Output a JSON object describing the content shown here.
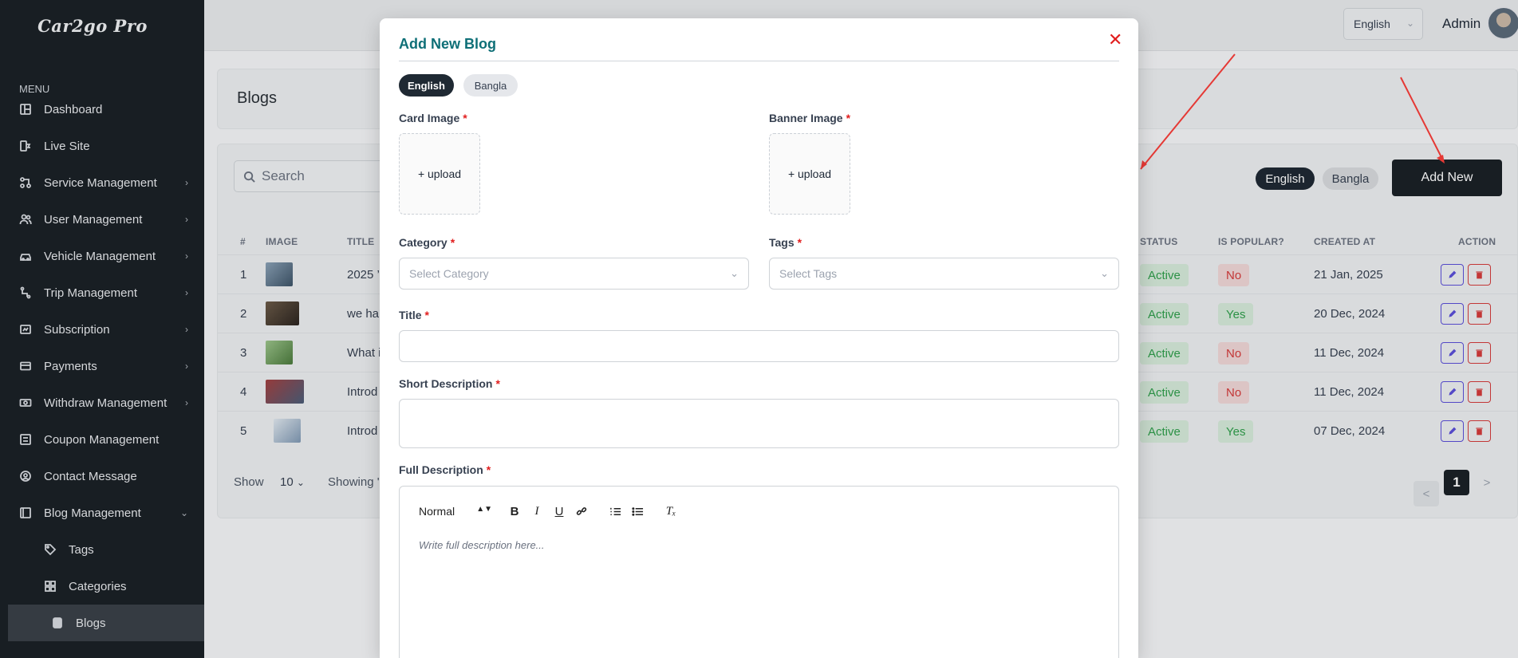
{
  "brand": {
    "logo_text": "Car2go Pro"
  },
  "sidebar": {
    "menu_title": "MENU",
    "items": [
      {
        "label": "Dashboard",
        "icon": "dashboard-icon",
        "has_children": false
      },
      {
        "label": "Live Site",
        "icon": "live-site-icon",
        "has_children": false
      },
      {
        "label": "Service Management",
        "icon": "service-icon",
        "has_children": true
      },
      {
        "label": "User Management",
        "icon": "users-icon",
        "has_children": true
      },
      {
        "label": "Vehicle Management",
        "icon": "car-icon",
        "has_children": true
      },
      {
        "label": "Trip Management",
        "icon": "trip-icon",
        "has_children": true
      },
      {
        "label": "Subscription",
        "icon": "subscription-icon",
        "has_children": true
      },
      {
        "label": "Payments",
        "icon": "payments-icon",
        "has_children": true
      },
      {
        "label": "Withdraw Management",
        "icon": "withdraw-icon",
        "has_children": true
      },
      {
        "label": "Coupon Management",
        "icon": "coupon-icon",
        "has_children": false
      },
      {
        "label": "Contact Message",
        "icon": "contact-icon",
        "has_children": false
      },
      {
        "label": "Blog Management",
        "icon": "blog-icon",
        "has_children": true,
        "expanded": true
      }
    ],
    "sub_items": [
      {
        "label": "Tags",
        "icon": "tags-icon"
      },
      {
        "label": "Categories",
        "icon": "categories-icon"
      },
      {
        "label": "Blogs",
        "icon": "blogs-icon",
        "active": true
      }
    ]
  },
  "header": {
    "language": "English",
    "admin_label": "Admin"
  },
  "page": {
    "title": "Blogs",
    "search_placeholder": "Search",
    "lang_tabs": [
      "English",
      "Bangla"
    ],
    "add_new_label": "Add New",
    "columns": {
      "num": "#",
      "image": "IMAGE",
      "title": "TITLE",
      "status": "STATUS",
      "popular": "IS POPULAR?",
      "created": "CREATED AT",
      "action": "ACTION"
    },
    "rows": [
      {
        "num": "1",
        "title": "2025 ’",
        "status": "Active",
        "popular": "No",
        "created": "21 Jan, 2025"
      },
      {
        "num": "2",
        "title": "we ha’",
        "status": "Active",
        "popular": "Yes",
        "created": "20 Dec, 2024"
      },
      {
        "num": "3",
        "title": "What i",
        "status": "Active",
        "popular": "No",
        "created": "11 Dec, 2024"
      },
      {
        "num": "4",
        "title": "Introd",
        "status": "Active",
        "popular": "No",
        "created": "11 Dec, 2024"
      },
      {
        "num": "5",
        "title": "Introd",
        "status": "Active",
        "popular": "Yes",
        "created": "07 Dec, 2024"
      }
    ],
    "show_label": "Show",
    "page_size": "10",
    "showing_text": "Showing '",
    "pagination": {
      "prev": "<",
      "current": "1",
      "next": ">"
    }
  },
  "modal": {
    "title": "Add New Blog",
    "close_glyph": "✕",
    "lang_tabs": [
      "English",
      "Bangla"
    ],
    "card_image_label": "Card Image",
    "banner_image_label": "Banner Image",
    "upload_text": "+ upload",
    "required_mark": "*",
    "category_label": "Category",
    "category_placeholder": "Select Category",
    "tags_label": "Tags",
    "tags_placeholder": "Select Tags",
    "title_label": "Title",
    "short_desc_label": "Short Description",
    "full_desc_label": "Full Description",
    "editor": {
      "format_value": "Normal",
      "placeholder": "Write full description here..."
    }
  },
  "colors": {
    "sidebar_bg": "#1b2127",
    "accent_teal": "#0e6f77",
    "danger": "#e11d1d",
    "success": "#2f9e4b",
    "annotation_arrow": "#e53935"
  }
}
